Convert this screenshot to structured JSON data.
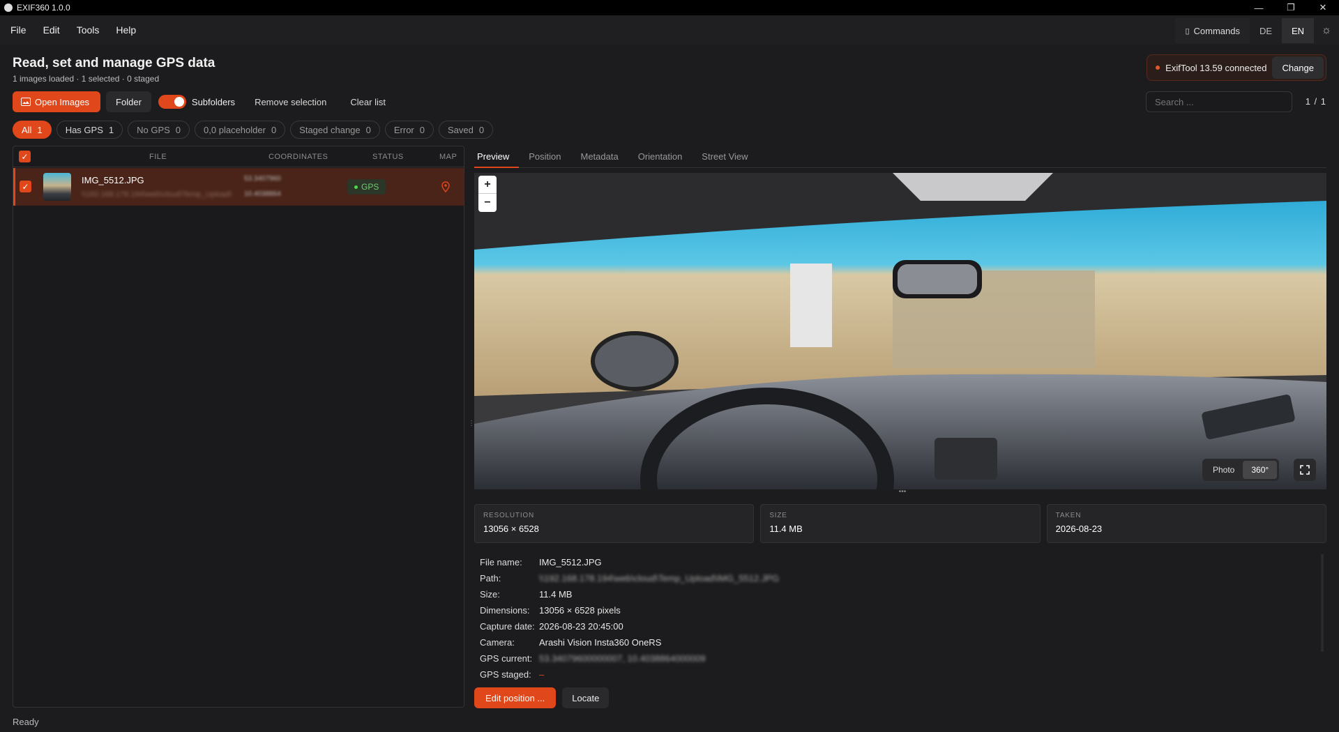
{
  "window": {
    "title": "EXIF360 1.0.0",
    "controls": [
      "—",
      "❐",
      "✕"
    ]
  },
  "menu": [
    "File",
    "Edit",
    "Tools",
    "Help"
  ],
  "topright": {
    "commands_label": "Commands",
    "langs": [
      "DE",
      "EN"
    ],
    "active_lang": "EN"
  },
  "header": {
    "title": "Read, set and manage GPS data",
    "subtitle": "1 images loaded · 1 selected · 0 staged"
  },
  "exiftool": {
    "status": "ExifTool 13.59 connected",
    "change_label": "Change"
  },
  "toolbar": {
    "open_images": "Open Images",
    "folder": "Folder",
    "subfolders": "Subfolders",
    "subfolders_on": true,
    "remove_selection": "Remove selection",
    "clear_list": "Clear list"
  },
  "search": {
    "placeholder": "Search ..."
  },
  "pager": "1 / 1",
  "filters": [
    {
      "label": "All",
      "count": "1"
    },
    {
      "label": "Has GPS",
      "count": "1"
    },
    {
      "label": "No GPS",
      "count": "0"
    },
    {
      "label": "0,0 placeholder",
      "count": "0"
    },
    {
      "label": "Staged change",
      "count": "0"
    },
    {
      "label": "Error",
      "count": "0"
    },
    {
      "label": "Saved",
      "count": "0"
    }
  ],
  "table": {
    "headers": {
      "file": "FILE",
      "coordinates": "COORDINATES",
      "status": "STATUS",
      "map": "MAP"
    },
    "rows": [
      {
        "name": "IMG_5512.JPG",
        "path": "\\\\192.168.178.194\\web\\cloud\\Temp_Upload\\",
        "lat": "53.3407960",
        "lon": "10.4038864",
        "status": "GPS"
      }
    ]
  },
  "tabs": [
    "Preview",
    "Position",
    "Metadata",
    "Orientation",
    "Street View"
  ],
  "preview": {
    "zoom_in": "+",
    "zoom_out": "−",
    "modes": [
      "Photo",
      "360°"
    ],
    "active_mode": "360°"
  },
  "cards": [
    {
      "label": "RESOLUTION",
      "value": "13056 × 6528"
    },
    {
      "label": "SIZE",
      "value": "11.4 MB"
    },
    {
      "label": "TAKEN",
      "value": "2026-08-23"
    }
  ],
  "details": [
    {
      "label": "File name:",
      "value": "IMG_5512.JPG"
    },
    {
      "label": "Path:",
      "value": "\\\\192.168.178.194\\web\\cloud\\Temp_Upload\\IMG_5512.JPG"
    },
    {
      "label": "Size:",
      "value": "11.4 MB"
    },
    {
      "label": "Dimensions:",
      "value": "13056 × 6528 pixels"
    },
    {
      "label": "Capture date:",
      "value": "2026-08-23 20:45:00"
    },
    {
      "label": "Camera:",
      "value": "Arashi Vision Insta360 OneRS"
    },
    {
      "label": "GPS current:",
      "value": "53.34079600000007, 10.4038864000009"
    },
    {
      "label": "GPS staged:",
      "value": "–"
    }
  ],
  "actions": {
    "edit_position": "Edit position ...",
    "locate": "Locate"
  },
  "statusbar": "Ready",
  "colors": {
    "accent": "#e0471a",
    "gps_green": "#6fcf6f",
    "background": "#1c1c1e"
  }
}
